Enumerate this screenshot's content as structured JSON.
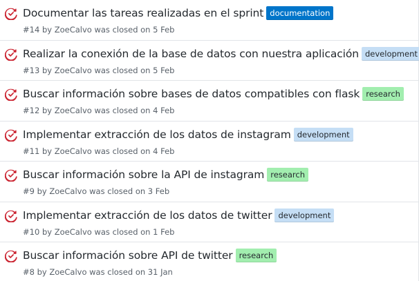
{
  "colors": {
    "closed_icon": "#cb2431",
    "label_documentation_bg": "#0075ca",
    "label_documentation_fg": "#ffffff",
    "label_development_bg": "#c5def5",
    "label_development_fg": "#24292e",
    "label_research_bg": "#a2eeaf",
    "label_research_fg": "#24292e"
  },
  "issues": [
    {
      "title": "Documentar las tareas realizadas en el sprint",
      "label": "documentation",
      "number": "#14",
      "by": "by",
      "author": "ZoeCalvo",
      "closed_text": "was closed on",
      "date": "5 Feb",
      "icon": "closed-issue-icon"
    },
    {
      "title": "Realizar la conexión de la base de datos con nuestra aplicación",
      "label": "development",
      "number": "#13",
      "by": "by",
      "author": "ZoeCalvo",
      "closed_text": "was closed on",
      "date": "5 Feb",
      "icon": "closed-issue-icon"
    },
    {
      "title": "Buscar información sobre bases de datos compatibles con flask",
      "label": "research",
      "number": "#12",
      "by": "by",
      "author": "ZoeCalvo",
      "closed_text": "was closed on",
      "date": "4 Feb",
      "icon": "closed-issue-icon"
    },
    {
      "title": "Implementar extracción de los datos de instagram",
      "label": "development",
      "number": "#11",
      "by": "by",
      "author": "ZoeCalvo",
      "closed_text": "was closed on",
      "date": "4 Feb",
      "icon": "closed-issue-icon"
    },
    {
      "title": "Buscar información sobre la API de instagram",
      "label": "research",
      "number": "#9",
      "by": "by",
      "author": "ZoeCalvo",
      "closed_text": "was closed on",
      "date": "3 Feb",
      "icon": "closed-issue-icon"
    },
    {
      "title": "Implementar extracción de los datos de twitter",
      "label": "development",
      "number": "#10",
      "by": "by",
      "author": "ZoeCalvo",
      "closed_text": "was closed on",
      "date": "1 Feb",
      "icon": "closed-issue-icon"
    },
    {
      "title": "Buscar información sobre API de twitter",
      "label": "research",
      "number": "#8",
      "by": "by",
      "author": "ZoeCalvo",
      "closed_text": "was closed on",
      "date": "31 Jan",
      "icon": "closed-issue-icon"
    }
  ]
}
